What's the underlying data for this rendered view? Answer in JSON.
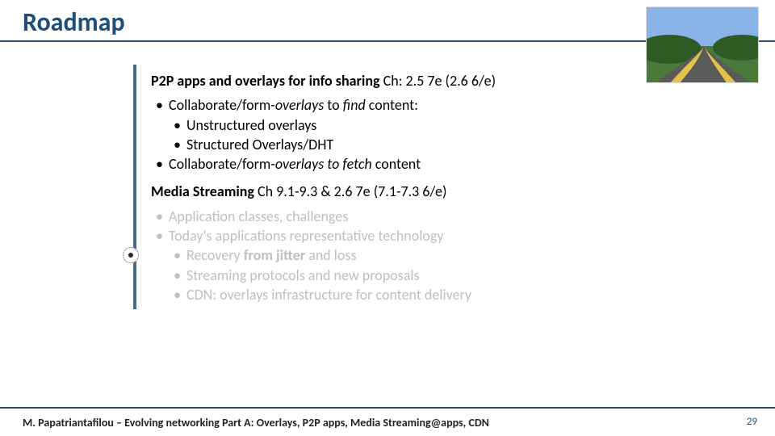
{
  "title": "Roadmap",
  "section1": {
    "heading_strong": "P2P apps and overlays  for info sharing",
    "heading_tail": " Ch: 2.5 7e (2.6 6/e)",
    "item1_pre": "Collaborate/form-",
    "item1_em": "overlays",
    "item1_mid": " to ",
    "item1_em2": "find",
    "item1_post": " content:",
    "sub1": "Unstructured overlays",
    "sub2": "Structured Overlays/DHT",
    "item2_pre": "Collaborate/form-",
    "item2_em": "overlays",
    "item2_mid": " ",
    "item2_em2": "to fetch",
    "item2_post": " content"
  },
  "section2": {
    "heading_strong": "Media Streaming",
    "heading_tail": " Ch 9.1-9.3 & 2.6 7e (7.1-7.3 6/e)",
    "b1": "Application classes, challenges",
    "b2": "Today's applications representative technology",
    "c1_pre": "Recovery ",
    "c1_strong": "from jitter",
    "c1_post": " and loss",
    "c2": "Streaming protocols and new proposals",
    "c3": "CDN: overlays infrastructure for content delivery"
  },
  "footer": "M. Papatriantafilou –  Evolving networking Part A: Overlays, P2P apps, Media Streaming@apps, CDN",
  "pageno": "29"
}
